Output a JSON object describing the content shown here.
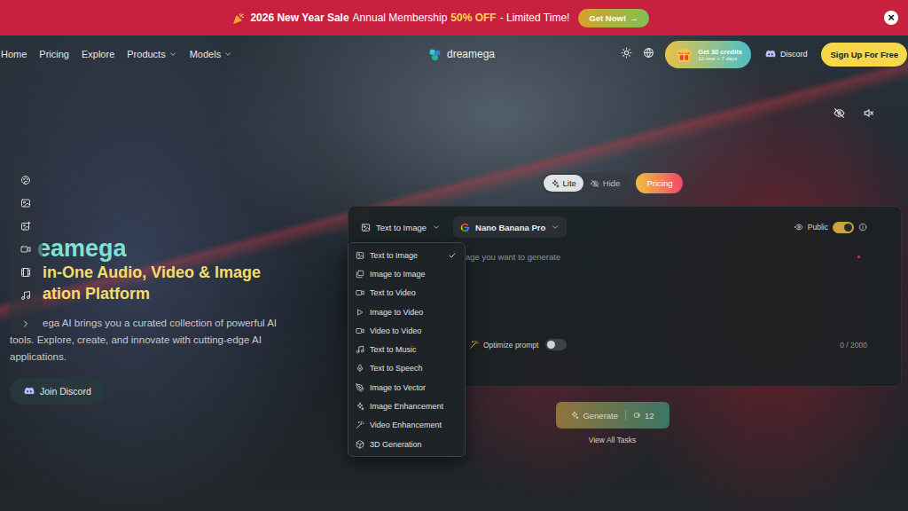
{
  "banner": {
    "highlight": "2026 New Year Sale",
    "text": "Annual Membership",
    "discount": "50% OFF",
    "suffix": "- Limited Time!",
    "cta": "Get Now!",
    "cta_arrow": "→",
    "close": "×"
  },
  "nav": {
    "links": [
      {
        "label": "Home",
        "kind": "link"
      },
      {
        "label": "Pricing",
        "kind": "link"
      },
      {
        "label": "Explore",
        "kind": "link"
      },
      {
        "label": "Products",
        "kind": "menu"
      },
      {
        "label": "Models",
        "kind": "menu"
      }
    ],
    "logo": "dreamega",
    "credits": {
      "title": "Get 30 credits",
      "subtitle": "12 new + 7 days"
    },
    "discord": "Discord",
    "signup": "Sign Up For Free"
  },
  "hero": {
    "title": "eamega",
    "subtitle_lines": [
      "in-One Audio, Video & Image",
      "ation Platform"
    ],
    "description_lines": [
      "ega AI brings you a curated collection of powerful AI",
      "tools. Explore, create, and innovate with cutting-edge AI",
      "applications."
    ],
    "discord_button": "Join Discord"
  },
  "mode": {
    "options": [
      {
        "label": "Lite",
        "selected": true
      },
      {
        "label": "Hide",
        "selected": false
      }
    ],
    "pricing": "Pricing"
  },
  "generator": {
    "type": "Text to Image",
    "model": "Nano Banana Pro",
    "public": {
      "label": "Public",
      "on": true
    },
    "prompt_placeholder": "age you want to generate",
    "optimize": {
      "label": "Optimize prompt",
      "on": false
    },
    "count": "0 / 2000",
    "generate": "Generate",
    "cost": "12",
    "view_tasks": "View All Tasks"
  },
  "type_menu": {
    "items": [
      {
        "label": "Text to Image",
        "selected": true
      },
      {
        "label": "Image to Image",
        "selected": false
      },
      {
        "label": "Text to Video",
        "selected": false
      },
      {
        "label": "Image to Video",
        "selected": false
      },
      {
        "label": "Video to Video",
        "selected": false
      },
      {
        "label": "Text to Music",
        "selected": false
      },
      {
        "label": "Text to Speech",
        "selected": false
      },
      {
        "label": "Image to Vector",
        "selected": false
      },
      {
        "label": "Image Enhancement",
        "selected": false
      },
      {
        "label": "Video Enhancement",
        "selected": false
      },
      {
        "label": "3D Generation",
        "selected": false
      }
    ]
  }
}
